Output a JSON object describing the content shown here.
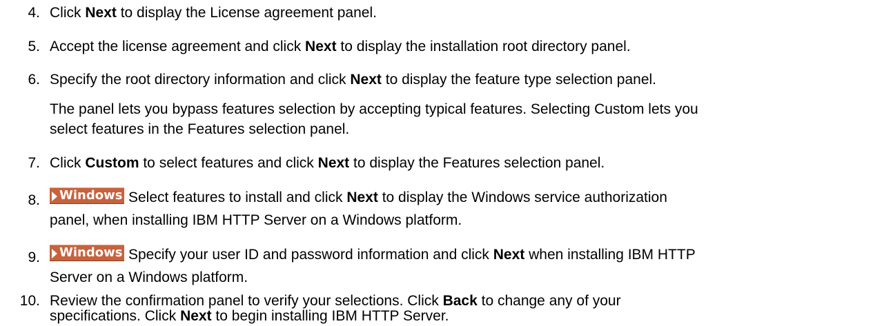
{
  "steps": [
    {
      "number": "4.",
      "parts": [
        "Click ",
        "Next",
        " to display the License agreement panel."
      ]
    },
    {
      "number": "5.",
      "parts": [
        "Accept the license agreement and click ",
        "Next",
        " to display the installation root directory panel."
      ]
    },
    {
      "number": "6.",
      "parts": [
        "Specify the root directory information and click ",
        "Next",
        " to display the feature type selection panel."
      ],
      "note_line1": "The panel lets you bypass features selection by accepting typical features. Selecting Custom lets you",
      "note_line2": "select features in the Features selection panel."
    },
    {
      "number": "7.",
      "parts": [
        "Click ",
        "Custom",
        " to select features and click ",
        "Next",
        " to display the Features selection panel."
      ]
    },
    {
      "number": "8.",
      "badge": "Windows",
      "line1_parts": [
        "Select features to install and click ",
        "Next",
        " to display the Windows service authorization"
      ],
      "line2": "panel, when installing IBM HTTP Server on a Windows platform."
    },
    {
      "number": "9.",
      "badge": "Windows",
      "line1_parts": [
        "Specify your user ID and password information and click ",
        "Next",
        " when installing IBM HTTP"
      ],
      "line2": "Server on a Windows platform."
    },
    {
      "number": "10.",
      "line1_parts": [
        "Review the confirmation panel to verify your selections. Click ",
        "Back",
        " to change any of your"
      ],
      "line2_parts": [
        "specifications. Click ",
        "Next",
        " to begin installing IBM HTTP Server."
      ]
    }
  ],
  "colors": {
    "badge_bg": "#c8623c",
    "badge_text": "#ffffff"
  }
}
